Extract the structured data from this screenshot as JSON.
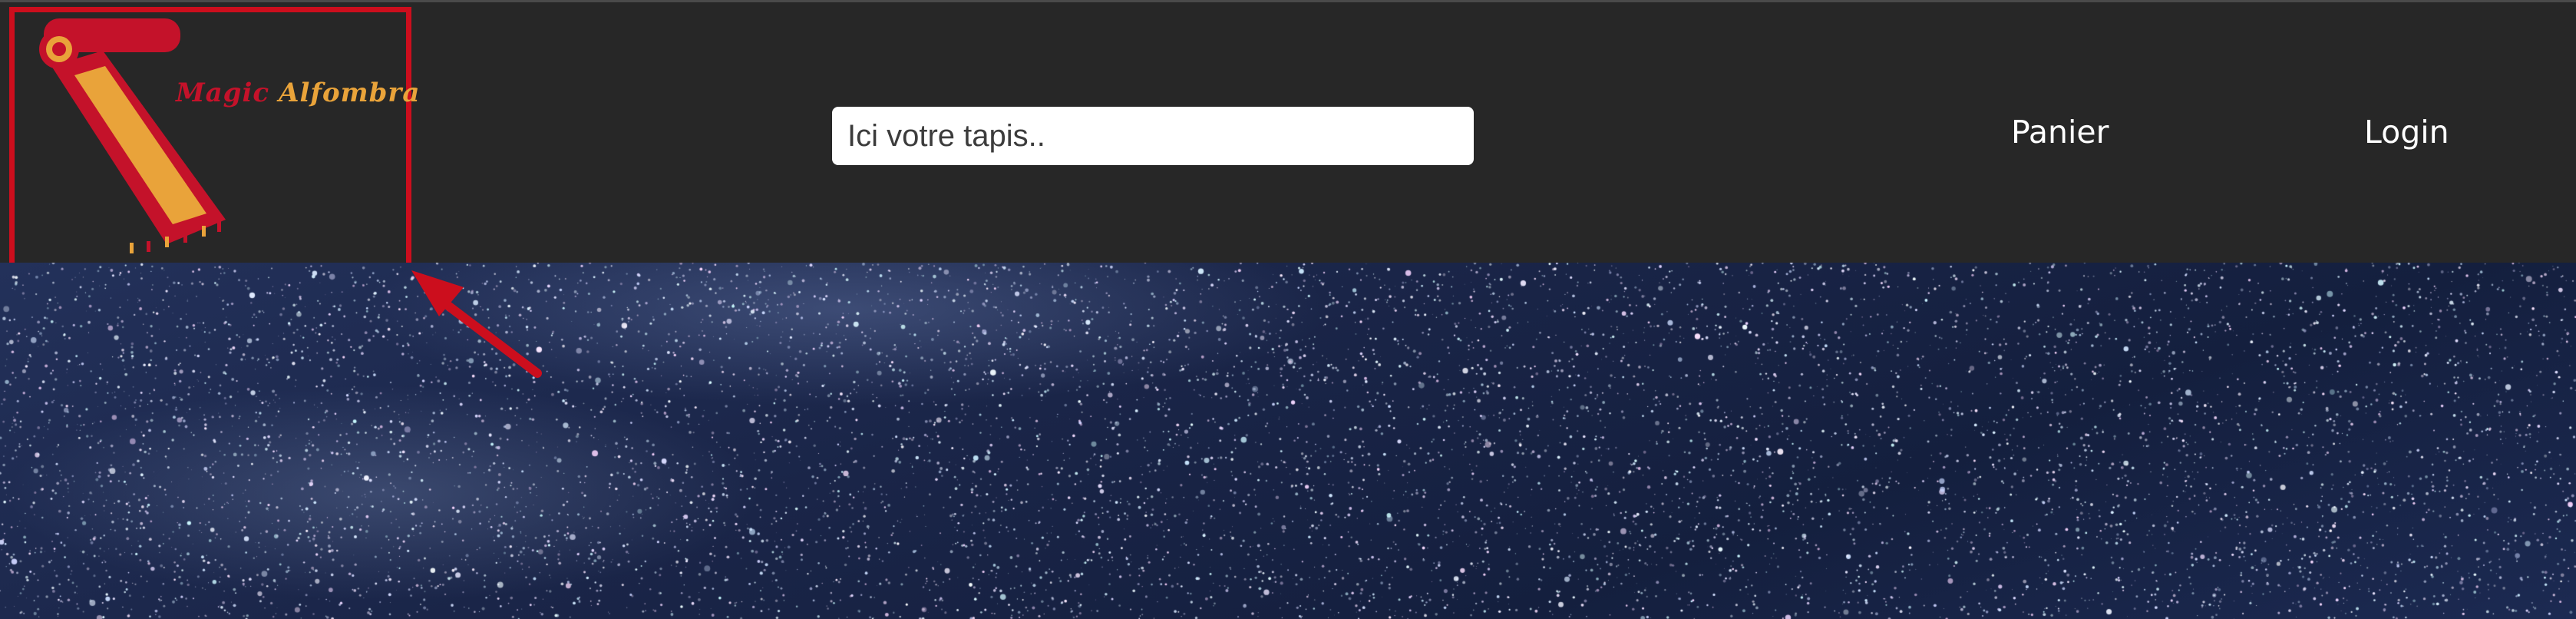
{
  "header": {
    "logo": {
      "word1": "Magic",
      "word2": "Alfombra",
      "colors": {
        "red": "#c4122a",
        "orange": "#e9a33a"
      }
    },
    "search": {
      "placeholder": "Ici votre tapis..",
      "value": ""
    },
    "nav": [
      {
        "label": "Panier"
      },
      {
        "label": "Login"
      }
    ]
  },
  "annotation": {
    "color": "#cc0e1d"
  },
  "hero": {
    "background": "starry-night-sky"
  }
}
